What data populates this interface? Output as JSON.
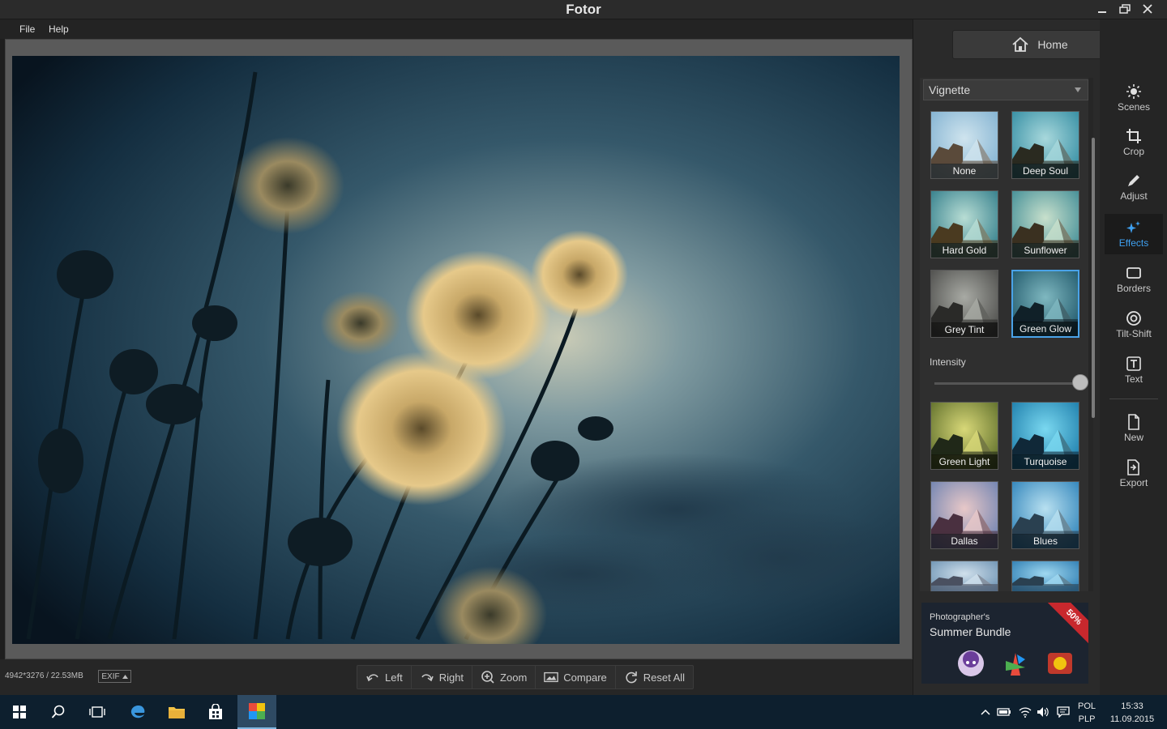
{
  "window": {
    "title": "Fotor"
  },
  "menu": {
    "file": "File",
    "help": "Help"
  },
  "status": {
    "file_info": "4942*3276 / 22.53MB",
    "exif_label": "EXIF"
  },
  "toolbar": {
    "left": "Left",
    "right": "Right",
    "zoom": "Zoom",
    "compare": "Compare",
    "reset": "Reset All"
  },
  "panel": {
    "home": "Home",
    "dropdown_value": "Vignette",
    "intensity_label": "Intensity",
    "intensity_value": 1.0,
    "effects": [
      {
        "label": "None"
      },
      {
        "label": "Deep Soul"
      },
      {
        "label": "Hard Gold"
      },
      {
        "label": "Sunflower"
      },
      {
        "label": "Grey Tint"
      },
      {
        "label": "Green Glow",
        "selected": true
      }
    ],
    "more_effects": [
      {
        "label": "Green Light"
      },
      {
        "label": "Turquoise"
      },
      {
        "label": "Dallas"
      },
      {
        "label": "Blues"
      }
    ]
  },
  "ad": {
    "line1": "Photographer's",
    "line2": "Summer Bundle",
    "badge": "50%"
  },
  "nav": {
    "scenes": "Scenes",
    "crop": "Crop",
    "adjust": "Adjust",
    "effects": "Effects",
    "borders": "Borders",
    "tilt_shift": "Tilt-Shift",
    "text": "Text",
    "new": "New",
    "export": "Export"
  },
  "taskbar": {
    "lang_top": "POL",
    "lang_bottom": "PLP",
    "time": "15:33",
    "date": "11.09.2015"
  },
  "colors": {
    "accent": "#3fa0f0",
    "selected_border": "#4aa3e8",
    "taskbar": "#0d1f2e"
  }
}
